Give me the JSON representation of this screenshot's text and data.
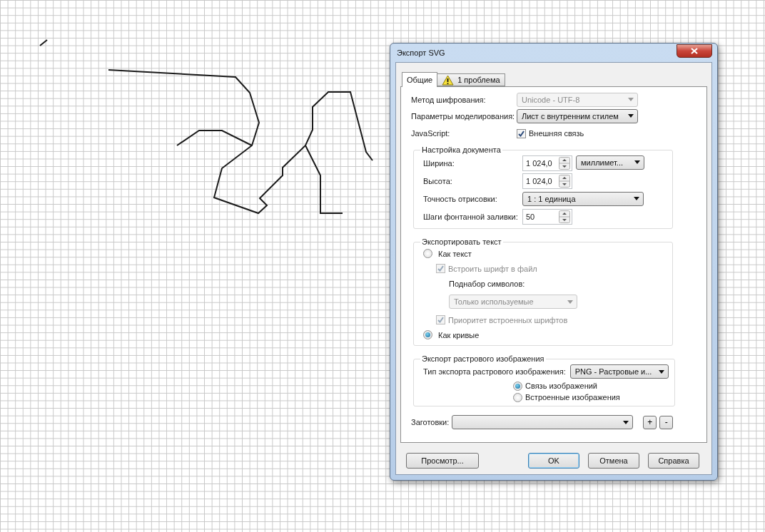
{
  "window": {
    "title": "Экспорт SVG"
  },
  "tabs": [
    {
      "label": "Общие",
      "selected": true,
      "kind": "plain"
    },
    {
      "label": "1 проблема",
      "selected": false,
      "kind": "warning"
    }
  ],
  "general": [
    {
      "kind": "select",
      "label": "Метод шифрования:",
      "value": "Unicode - UTF-8",
      "disabled": true
    },
    {
      "kind": "select",
      "label": "Параметры моделирования:",
      "value": "Лист с внутренним стилем",
      "disabled": false
    },
    {
      "kind": "checkbox",
      "label": "JavaScript:",
      "option": "Внешняя связь",
      "checked": true
    }
  ],
  "document": {
    "title": "Настройка документа",
    "rows": [
      {
        "kind": "spin_unit",
        "label": "Ширина:",
        "value": "1 024,0",
        "unit": "миллимет..."
      },
      {
        "kind": "spin",
        "label": "Высота:",
        "value": "1 024,0"
      },
      {
        "kind": "select",
        "label": "Точность отрисовки:",
        "value": "1 : 1 единица"
      },
      {
        "kind": "spin",
        "label": "Шаги фонтанной заливки:",
        "value": "50"
      }
    ]
  },
  "export_text": {
    "title": "Экспортировать текст",
    "options": [
      {
        "kind": "radio",
        "label": "Как текст",
        "selected": false,
        "children": [
          {
            "kind": "checkbox",
            "label": "Встроить шрифт в файл",
            "checked": true,
            "disabled": true,
            "children": [
              {
                "kind": "label",
                "label": "Поднабор символов:"
              },
              {
                "kind": "select",
                "value": "Только используемые",
                "disabled": true
              }
            ]
          },
          {
            "kind": "checkbox",
            "label": "Приоритет встроенных шрифтов",
            "checked": true,
            "disabled": true
          }
        ]
      },
      {
        "kind": "radio",
        "label": "Как кривые",
        "selected": true
      }
    ]
  },
  "raster": {
    "title": "Экспорт растрового изображения",
    "type": {
      "label": "Тип экспорта растрового изображения:",
      "value": "PNG - Растровые и..."
    },
    "options": [
      {
        "label": "Связь изображений",
        "selected": true
      },
      {
        "label": "Встроенные изображения",
        "selected": false
      }
    ]
  },
  "presets": {
    "label": "Заготовки:",
    "buttons": [
      "+",
      "-"
    ]
  },
  "buttons": [
    {
      "label": "Просмотр...",
      "default": false
    },
    {
      "label": "OK",
      "default": true
    },
    {
      "label": "Отмена",
      "default": false
    },
    {
      "label": "Справка",
      "default": false
    }
  ]
}
